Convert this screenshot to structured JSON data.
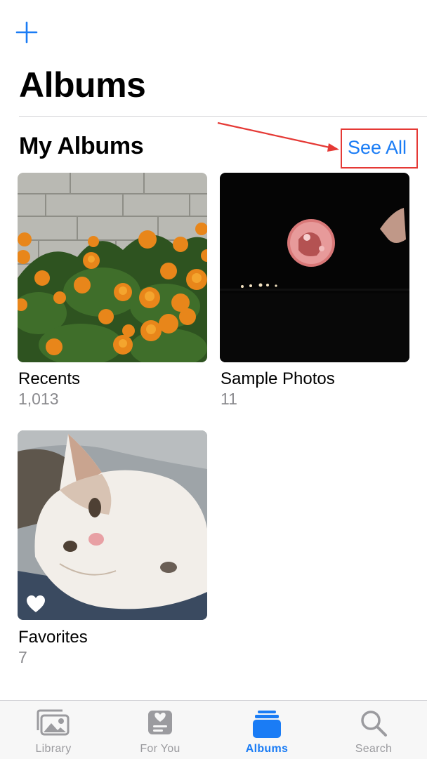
{
  "header": {
    "title": "Albums",
    "add_icon": "plus-icon"
  },
  "my_albums": {
    "section_title": "My Albums",
    "see_all_label": "See All",
    "albums": [
      {
        "name": "Recents",
        "count": "1,013"
      },
      {
        "name": "Sample Photos",
        "count": "11"
      },
      {
        "name": "Favorites",
        "count": "7"
      }
    ]
  },
  "tabbar": {
    "tabs": [
      {
        "label": "Library",
        "icon": "photo-library-icon",
        "active": false
      },
      {
        "label": "For You",
        "icon": "for-you-icon",
        "active": false
      },
      {
        "label": "Albums",
        "icon": "albums-icon",
        "active": true
      },
      {
        "label": "Search",
        "icon": "search-icon",
        "active": false
      }
    ]
  },
  "colors": {
    "accent": "#1a7cf5",
    "annotation": "#e53935",
    "secondary_text": "#8a8a8e"
  }
}
